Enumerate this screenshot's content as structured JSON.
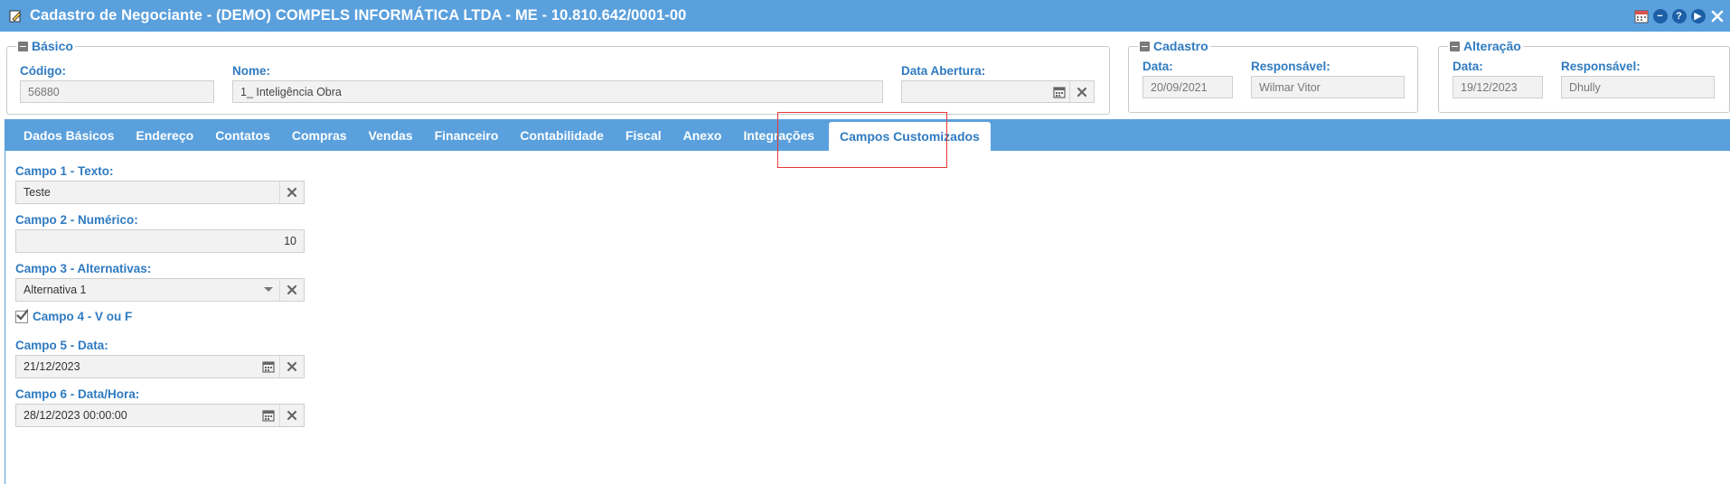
{
  "window": {
    "title": "Cadastro de Negociante - (DEMO) COMPELS INFORMÁTICA LTDA - ME - 10.810.642/0001-00",
    "icons": [
      "edit-icon",
      "calendar-icon",
      "minimize-icon",
      "help-icon",
      "play-icon",
      "close-icon"
    ]
  },
  "basico": {
    "legend": "Básico",
    "codigo_label": "Código:",
    "codigo_value": "56880",
    "nome_label": "Nome:",
    "nome_value": "1_ Inteligência Obra",
    "data_abertura_label": "Data Abertura:",
    "data_abertura_value": ""
  },
  "cadastro": {
    "legend": "Cadastro",
    "data_label": "Data:",
    "data_value": "20/09/2021",
    "responsavel_label": "Responsável:",
    "responsavel_value": "Wilmar Vitor"
  },
  "alteracao": {
    "legend": "Alteração",
    "data_label": "Data:",
    "data_value": "19/12/2023",
    "responsavel_label": "Responsável:",
    "responsavel_value": "Dhully"
  },
  "tabs": [
    {
      "label": "Dados Básicos"
    },
    {
      "label": "Endereço"
    },
    {
      "label": "Contatos"
    },
    {
      "label": "Compras"
    },
    {
      "label": "Vendas"
    },
    {
      "label": "Financeiro"
    },
    {
      "label": "Contabilidade"
    },
    {
      "label": "Fiscal"
    },
    {
      "label": "Anexo"
    },
    {
      "label": "Integrações"
    },
    {
      "label": "Campos Customizados",
      "active": true
    }
  ],
  "campos": {
    "campo1_label": "Campo 1 - Texto:",
    "campo1_value": "Teste",
    "campo2_label": "Campo 2 - Numérico:",
    "campo2_value": "10",
    "campo3_label": "Campo 3 - Alternativas:",
    "campo3_value": "Alternativa 1",
    "campo4_label": "Campo 4 - V ou F",
    "campo4_checked": true,
    "campo5_label": "Campo 5 - Data:",
    "campo5_value": "21/12/2023",
    "campo6_label": "Campo 6 - Data/Hora:",
    "campo6_value": "28/12/2023 00:00:00"
  },
  "colors": {
    "primary": "#5aa0dd",
    "label": "#2f7bc1",
    "highlight": "#e53935"
  }
}
